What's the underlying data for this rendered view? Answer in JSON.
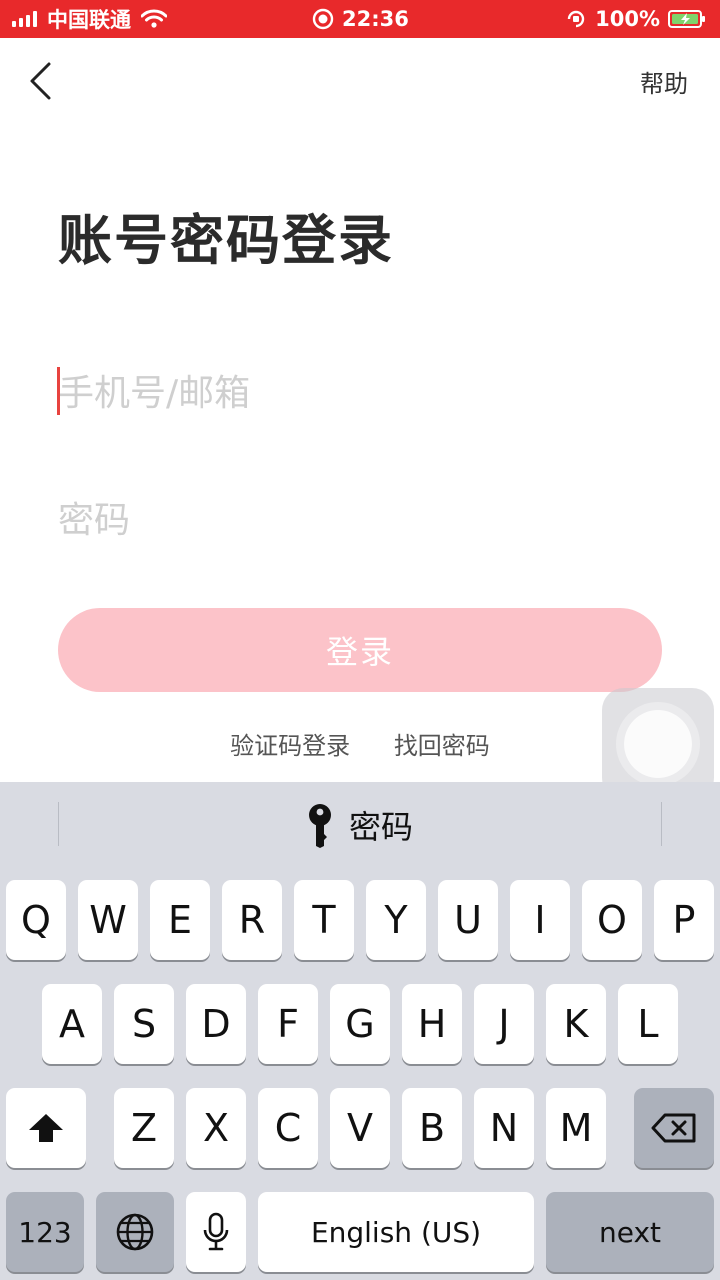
{
  "status_bar": {
    "carrier": "中国联通",
    "time": "22:36",
    "battery": "100%"
  },
  "nav": {
    "help_label": "帮助"
  },
  "form": {
    "title": "账号密码登录",
    "phone_placeholder": "手机号/邮箱",
    "password_placeholder": "密码",
    "login_label": "登录"
  },
  "links": {
    "code_login": "验证码登录",
    "find_password": "找回密码"
  },
  "keyboard": {
    "suggestion": "密码",
    "row1": [
      "Q",
      "W",
      "E",
      "R",
      "T",
      "Y",
      "U",
      "I",
      "O",
      "P"
    ],
    "row2": [
      "A",
      "S",
      "D",
      "F",
      "G",
      "H",
      "J",
      "K",
      "L"
    ],
    "row3": [
      "Z",
      "X",
      "C",
      "V",
      "B",
      "N",
      "M"
    ],
    "numbers_label": "123",
    "space_label": "English (US)",
    "return_label": "next"
  },
  "colors": {
    "accent": "#e8292b",
    "button_disabled": "#fcc3c9",
    "keyboard_bg": "#d9dbe2"
  }
}
